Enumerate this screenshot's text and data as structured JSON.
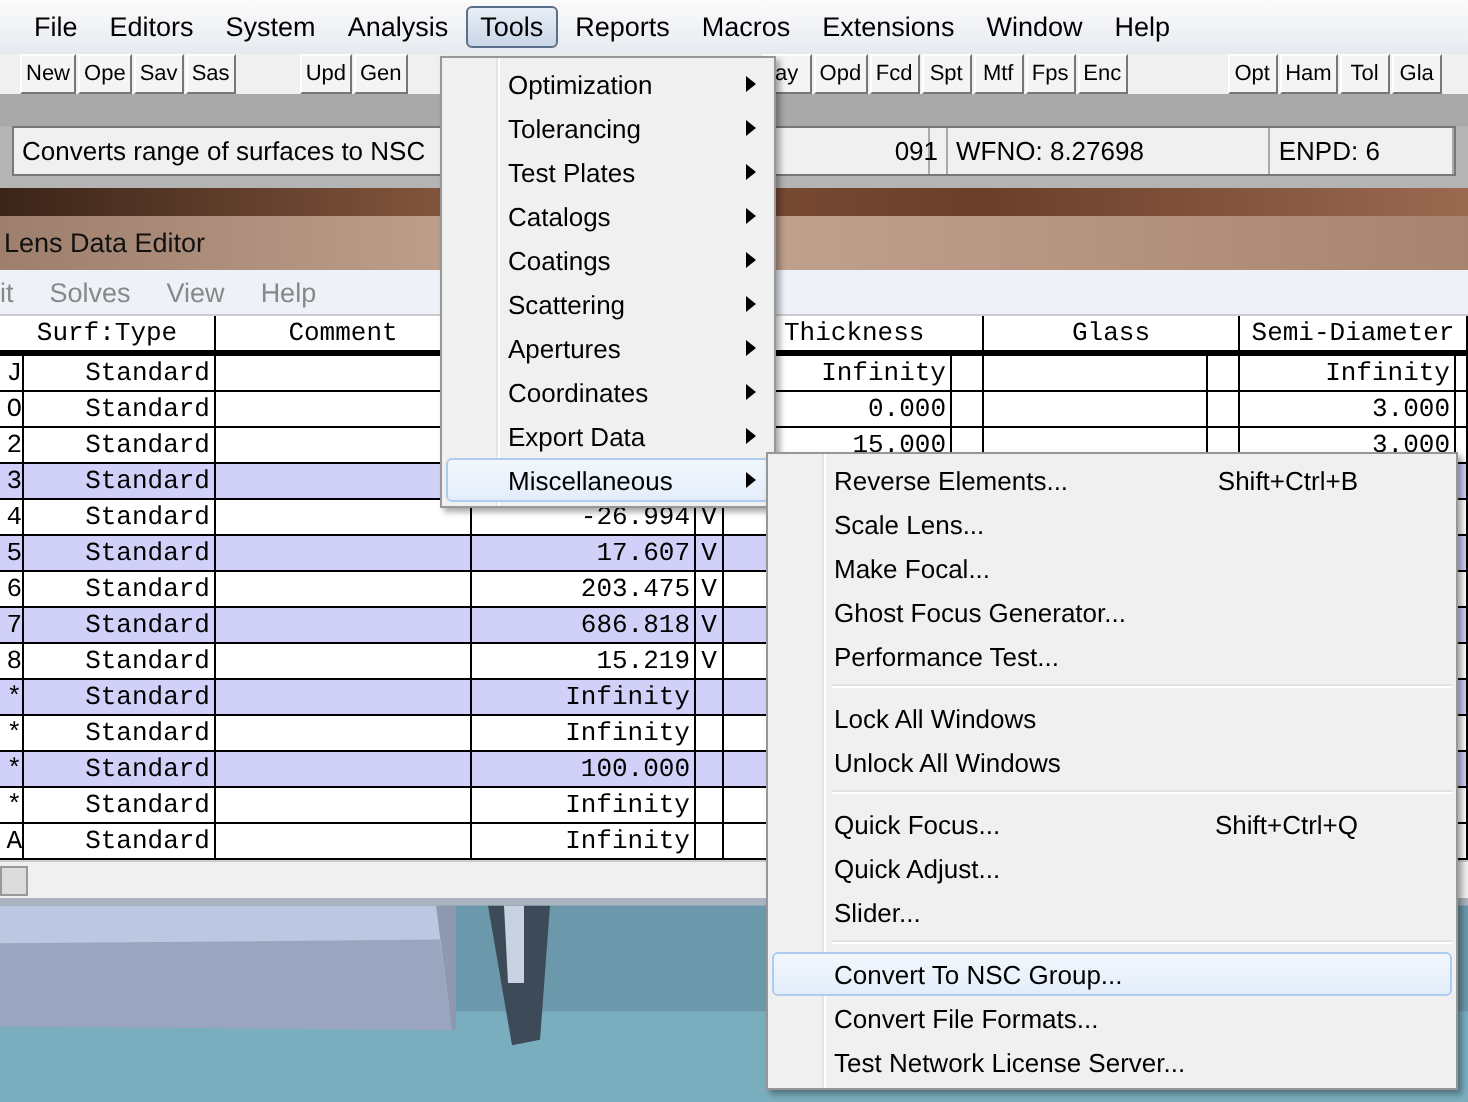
{
  "main_window": {
    "menu": [
      {
        "label": "File",
        "selected": false
      },
      {
        "label": "Editors",
        "selected": false
      },
      {
        "label": "System",
        "selected": false
      },
      {
        "label": "Analysis",
        "selected": false
      },
      {
        "label": "Tools",
        "selected": true
      },
      {
        "label": "Reports",
        "selected": false
      },
      {
        "label": "Macros",
        "selected": false
      },
      {
        "label": "Extensions",
        "selected": false
      },
      {
        "label": "Window",
        "selected": false
      },
      {
        "label": "Help",
        "selected": false
      }
    ],
    "toolbar": [
      [
        "New",
        "Ope",
        "Sav",
        "Sas"
      ],
      [
        "Upd",
        "Gen"
      ],
      [
        "ay",
        "Opd",
        "Fcd",
        "Spt",
        "Mtf",
        "Fps",
        "Enc"
      ],
      [
        "Opt",
        "Ham",
        "Tol",
        "Gla"
      ]
    ],
    "status": [
      "Converts range of surfaces to NSC",
      "091",
      "WFNO: 8.27698",
      "ENPD: 6"
    ]
  },
  "lens_data_editor": {
    "title": "Lens Data Editor",
    "menu": [
      "it",
      "Solves",
      "View",
      "Help"
    ],
    "columns": [
      "Surf:Type",
      "Comment",
      "Thickness",
      "Glass",
      "Semi-Diameter"
    ],
    "rows": [
      {
        "surf": "J",
        "type": "Standard",
        "thickness": "Infinity",
        "semi_diameter": "Infinity",
        "highlighted": false
      },
      {
        "surf": "O",
        "type": "Standard",
        "thickness": "0.000",
        "semi_diameter": "3.000",
        "highlighted": false
      },
      {
        "surf": "2",
        "type": "Standard",
        "thickness": "15.000",
        "semi_diameter": "3.000",
        "highlighted": false
      },
      {
        "surf": "3",
        "type": "Standard",
        "highlighted": true
      },
      {
        "surf": "4",
        "type": "Standard",
        "radius": "-26.994",
        "radius_solve": "V",
        "highlighted": false
      },
      {
        "surf": "5",
        "type": "Standard",
        "radius": "17.607",
        "radius_solve": "V",
        "highlighted": true
      },
      {
        "surf": "6",
        "type": "Standard",
        "radius": "203.475",
        "radius_solve": "V",
        "highlighted": false
      },
      {
        "surf": "7",
        "type": "Standard",
        "radius": "686.818",
        "radius_solve": "V",
        "highlighted": true
      },
      {
        "surf": "8",
        "type": "Standard",
        "radius": "15.219",
        "radius_solve": "V",
        "highlighted": false
      },
      {
        "surf": "*",
        "type": "Standard",
        "radius": "Infinity",
        "highlighted": true
      },
      {
        "surf": "*",
        "type": "Standard",
        "radius": "Infinity",
        "highlighted": false
      },
      {
        "surf": "*",
        "type": "Standard",
        "radius": "100.000",
        "highlighted": true
      },
      {
        "surf": "*",
        "type": "Standard",
        "radius": "Infinity",
        "highlighted": false
      },
      {
        "surf": "A",
        "type": "Standard",
        "radius": "Infinity",
        "highlighted": false
      }
    ]
  },
  "tools_menu": [
    {
      "label": "Optimization",
      "selected": false
    },
    {
      "label": "Tolerancing",
      "selected": false
    },
    {
      "label": "Test Plates",
      "selected": false
    },
    {
      "label": "Catalogs",
      "selected": false
    },
    {
      "label": "Coatings",
      "selected": false
    },
    {
      "label": "Scattering",
      "selected": false
    },
    {
      "label": "Apertures",
      "selected": false
    },
    {
      "label": "Coordinates",
      "selected": false
    },
    {
      "label": "Export Data",
      "selected": false
    },
    {
      "label": "Miscellaneous",
      "selected": true
    }
  ],
  "miscellaneous_menu": [
    [
      {
        "label": "Reverse Elements...",
        "shortcut": "Shift+Ctrl+B",
        "selected": false
      },
      {
        "label": "Scale Lens...",
        "selected": false
      },
      {
        "label": "Make Focal...",
        "selected": false
      },
      {
        "label": "Ghost Focus Generator...",
        "selected": false
      },
      {
        "label": "Performance Test...",
        "selected": false
      }
    ],
    [
      {
        "label": "Lock All Windows",
        "selected": false
      },
      {
        "label": "Unlock All Windows",
        "selected": false
      }
    ],
    [
      {
        "label": "Quick Focus...",
        "shortcut": "Shift+Ctrl+Q",
        "selected": false
      },
      {
        "label": "Quick Adjust...",
        "selected": false
      },
      {
        "label": "Slider...",
        "selected": false
      }
    ],
    [
      {
        "label": "Convert To NSC Group...",
        "selected": true
      },
      {
        "label": "Convert File Formats...",
        "selected": false
      },
      {
        "label": "Test Network License Server...",
        "selected": false
      }
    ]
  ]
}
